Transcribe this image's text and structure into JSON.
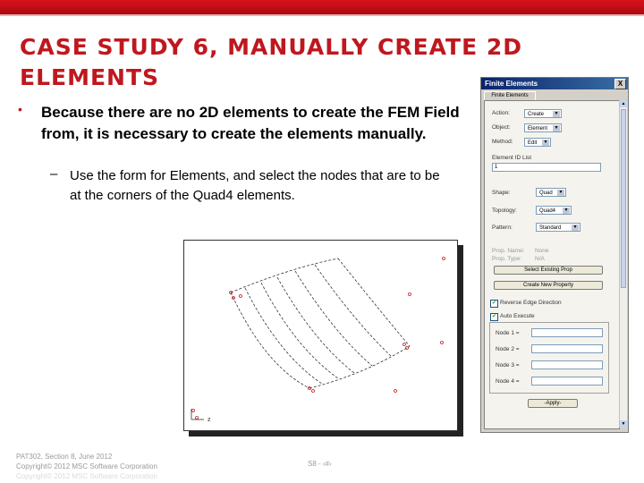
{
  "slide": {
    "title": "CASE STUDY 6, MANUALLY CREATE 2D ELEMENTS",
    "bullet": "Because there are no 2D elements to create the FEM Field from, it is necessary to create the elements manually.",
    "sub_bullet": "Use the form for Elements, and select the nodes that are to be at the corners of the Quad4 elements.",
    "bullet_marker": "•",
    "sub_marker": "–"
  },
  "dialog": {
    "title": "Finite Elements",
    "close_label": "X",
    "tab_label": "Finite Elements",
    "action_label": "Action:",
    "action_value": "Create",
    "object_label": "Object:",
    "object_value": "Element",
    "method_label": "Method:",
    "method_value": "Edit",
    "element_id_label": "Element ID List",
    "element_id_value": "1",
    "shape_label": "Shape:",
    "shape_value": "Quad",
    "topology_label": "Topology:",
    "topology_value": "Quad4",
    "pattern_label": "Pattern:",
    "pattern_value": "Standard",
    "prop_name_label": "Prop. Name:",
    "prop_name_value": "None",
    "prop_type_label": "Prop. Type:",
    "prop_type_value": "N/A",
    "select_existing_btn": "Select Existing Prop",
    "create_new_btn": "Create New Property",
    "reverse_check_label": "Reverse Edge Direction",
    "auto_execute_label": "Auto Execute",
    "node1_label": "Node 1 =",
    "node2_label": "Node 2 =",
    "node3_label": "Node 3 =",
    "node4_label": "Node 4 =",
    "apply_btn": "-Apply-",
    "checkmark": "✔"
  },
  "footer": {
    "course": "PAT302, Section 8, June 2012",
    "copyright": "Copyright© 2012 MSC Software Corporation",
    "faded": "Copyright© 2012 MSC Software Corporation",
    "page": "S8 - ‹#›"
  },
  "figure": {
    "axis_label": "z"
  }
}
